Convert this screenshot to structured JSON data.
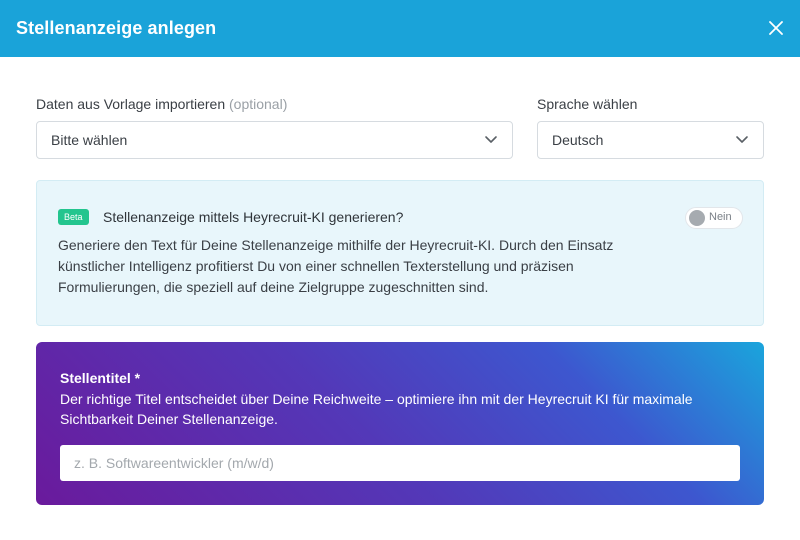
{
  "header": {
    "title": "Stellenanzeige anlegen"
  },
  "template_field": {
    "label": "Daten aus Vorlage importieren",
    "optional": "(optional)",
    "value": "Bitte wählen"
  },
  "language_field": {
    "label": "Sprache wählen",
    "value": "Deutsch"
  },
  "ai_section": {
    "badge": "Beta",
    "title": "Stellenanzeige mittels Heyrecruit-KI generieren?",
    "description": "Generiere den Text für Deine Stellenanzeige mithilfe der Heyrecruit-KI. Durch den Einsatz künstlicher Intelligenz profitierst Du von einer schnellen Texterstellung und präzisen Formulierungen, die speziell auf deine Zielgruppe zugeschnitten sind.",
    "toggle_label": "Nein",
    "toggle_on": false
  },
  "job_title": {
    "label": "Stellentitel *",
    "description": "Der richtige Titel entscheidet über Deine Reichweite – optimiere ihn mit der Heyrecruit KI für maximale Sichtbarkeit Deiner Stellenanzeige.",
    "placeholder": "z. B. Softwareentwickler (m/w/d)",
    "value": ""
  },
  "colors": {
    "header": "#1aa3d9",
    "beta_badge": "#23c58e",
    "ai_box_bg": "#e8f6fb",
    "gradient_start": "#6a1a9c",
    "gradient_end": "#1aa5dc"
  }
}
